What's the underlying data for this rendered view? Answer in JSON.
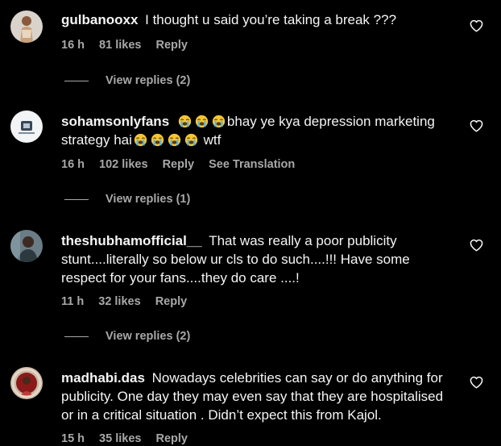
{
  "colors": {
    "background": "#000000",
    "primary_text": "#f5f5f5",
    "secondary_text": "#a8a8a8"
  },
  "comments": [
    {
      "username": "gulbanooxx",
      "text": "I thought u said you’re taking a break ???",
      "time": "16 h",
      "likes": "81 likes",
      "reply": "Reply",
      "view_replies": "View replies (2)"
    },
    {
      "username": "sohamsonlyfans",
      "text_part1": "bhay ye kya depression marketing strategy hai",
      "text_part2": "wtf",
      "emoji": "loudly-crying-face-emoji",
      "time": "16 h",
      "likes": "102 likes",
      "reply": "Reply",
      "translation": "See Translation",
      "view_replies": "View replies (1)"
    },
    {
      "username": "theshubhamofficial__",
      "text": "That was really a poor publicity stunt....literally so below ur cls to do such....!!! Have some respect for your fans....they do care ....!",
      "time": "11 h",
      "likes": "32 likes",
      "reply": "Reply",
      "view_replies": "View replies (2)"
    },
    {
      "username": "madhabi.das",
      "text": "Nowadays celebrities can say or do anything for publicity. One day they may even say that they are hospitalised or in a critical situation . Didn’t expect this from Kajol.",
      "time": "15 h",
      "likes": "35 likes",
      "reply": "Reply"
    }
  ],
  "icons": {
    "like": "heart-outline-icon"
  }
}
